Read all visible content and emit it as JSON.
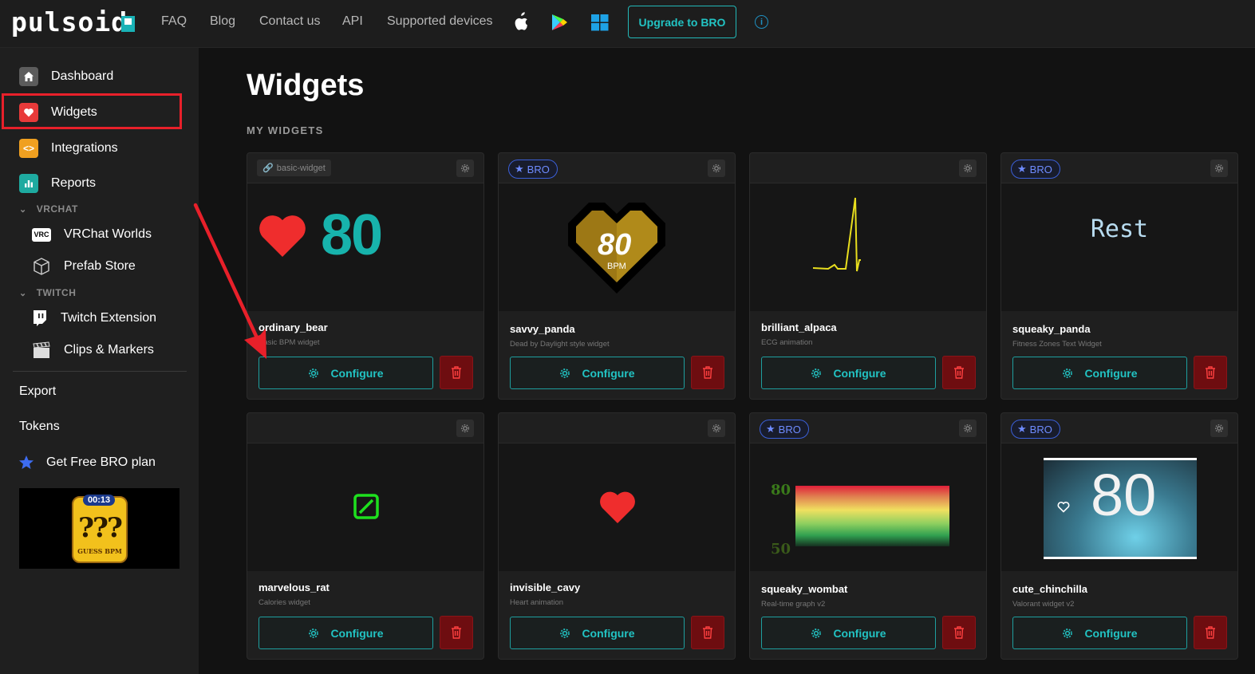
{
  "app": {
    "logo": "pulsoid",
    "nav": [
      "FAQ",
      "Blog",
      "Contact us",
      "API",
      "Supported devices"
    ],
    "platform_icons": [
      "apple-icon",
      "google-play-icon",
      "windows-icon"
    ],
    "upgrade_label": "Upgrade to BRO",
    "info_label": "i"
  },
  "sidebar": {
    "items": [
      {
        "label": "Dashboard",
        "icon": "home-icon"
      },
      {
        "label": "Widgets",
        "icon": "heart-icon"
      },
      {
        "label": "Integrations",
        "icon": "code-icon"
      },
      {
        "label": "Reports",
        "icon": "chart-icon"
      }
    ],
    "vrchat_section": "VRCHAT",
    "vrchat_items": [
      {
        "label": "VRChat Worlds",
        "icon": "vrc-icon"
      },
      {
        "label": "Prefab Store",
        "icon": "box-icon"
      }
    ],
    "twitch_section": "TWITCH",
    "twitch_items": [
      {
        "label": "Twitch Extension",
        "icon": "twitch-icon"
      },
      {
        "label": "Clips & Markers",
        "icon": "clapper-icon"
      }
    ],
    "export_label": "Export",
    "tokens_label": "Tokens",
    "free_bro_label": "Get Free BRO plan",
    "promo": {
      "timer": "00:13",
      "marks": "???",
      "caption": "GUESS BPM"
    }
  },
  "main": {
    "title": "Widgets",
    "section": "MY WIDGETS",
    "configure_label": "Configure",
    "bro_label": "BRO",
    "widgets": [
      {
        "name": "ordinary_bear",
        "desc": "Basic BPM widget",
        "badge": "basic-widget",
        "preview_value": "80"
      },
      {
        "name": "savvy_panda",
        "desc": "Dead by Daylight style widget",
        "badge": "BRO",
        "preview_value": "80",
        "preview_unit": "BPM"
      },
      {
        "name": "brilliant_alpaca",
        "desc": "ECG animation",
        "badge": ""
      },
      {
        "name": "squeaky_panda",
        "desc": "Fitness Zones Text Widget",
        "badge": "BRO",
        "preview_text": "Rest"
      },
      {
        "name": "marvelous_rat",
        "desc": "Calories widget",
        "badge": ""
      },
      {
        "name": "invisible_cavy",
        "desc": "Heart animation",
        "badge": ""
      },
      {
        "name": "squeaky_wombat",
        "desc": "Real-time graph v2",
        "badge": "BRO",
        "graph_max": "80",
        "graph_min": "50"
      },
      {
        "name": "cute_chinchilla",
        "desc": "Valorant widget v2",
        "badge": "BRO",
        "preview_value": "80"
      }
    ]
  },
  "colors": {
    "accent": "#22c3c3",
    "danger": "#e8202a",
    "bro": "#3b5fd8"
  }
}
